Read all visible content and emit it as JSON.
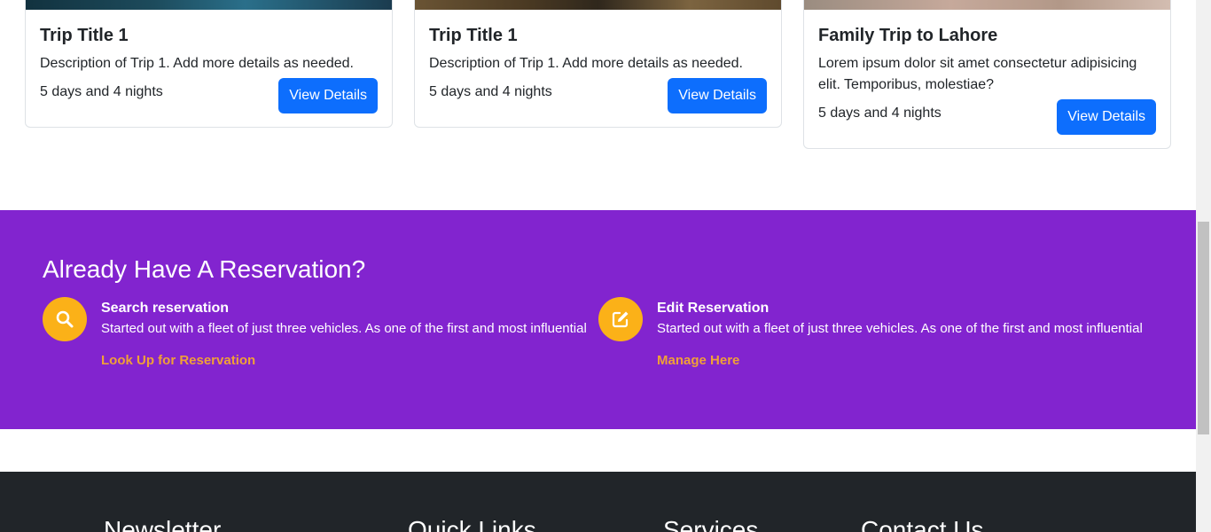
{
  "trips": [
    {
      "title": "Trip Title 1",
      "description": "Description of Trip 1. Add more details as needed.",
      "duration": "5 days and 4 nights",
      "button_label": "View Details"
    },
    {
      "title": "Trip Title 1",
      "description": "Description of Trip 1. Add more details as needed.",
      "duration": "5 days and 4 nights",
      "button_label": "View Details"
    },
    {
      "title": "Family Trip to Lahore",
      "description": "Lorem ipsum dolor sit amet consectetur adipisicing elit. Temporibus, molestiae?",
      "duration": "5 days and 4 nights",
      "button_label": "View Details"
    }
  ],
  "reservation": {
    "heading": "Already Have A Reservation?",
    "items": [
      {
        "icon": "search-icon",
        "title": "Search reservation",
        "description": "Started out with a fleet of just three vehicles. As one of the first and most influential",
        "link": "Look Up for Reservation"
      },
      {
        "icon": "edit-icon",
        "title": "Edit Reservation",
        "description": "Started out with a fleet of just three vehicles. As one of the first and most influential",
        "link": "Manage Here"
      }
    ]
  },
  "footer": {
    "columns": [
      "Newsletter",
      "Quick Links",
      "Services",
      "Contact Us"
    ]
  },
  "colors": {
    "reservation_bg": "#8224cf",
    "icon_bg": "#fbb118",
    "link": "#f0a037",
    "button": "#0d6efd",
    "footer_bg": "#212529"
  }
}
